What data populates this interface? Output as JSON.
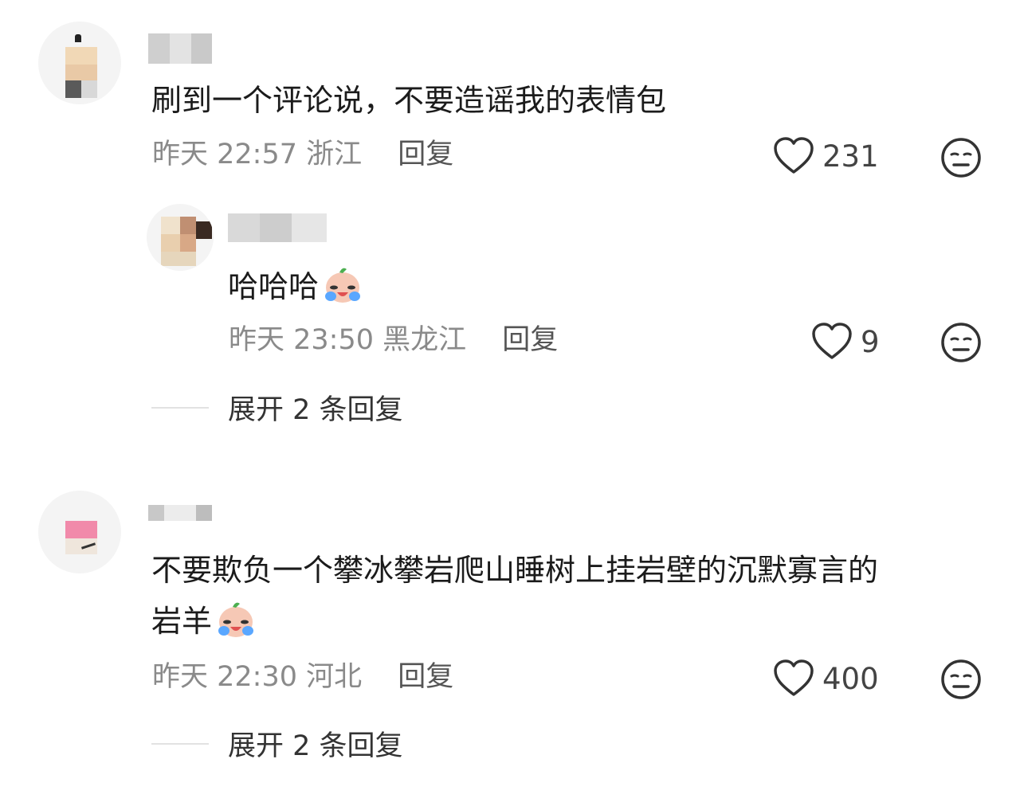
{
  "comments": [
    {
      "text": "刷到一个评论说，不要造谣我的表情包",
      "time": "昨天 22:57",
      "location": "浙江",
      "reply_label": "回复",
      "likes": "231",
      "reply": {
        "text": "哈哈哈",
        "emoji": "laugh-cry-emoji",
        "time": "昨天 23:50",
        "location": "黑龙江",
        "reply_label": "回复",
        "likes": "9"
      },
      "expand_label": "展开 2 条回复"
    },
    {
      "text_line1": "不要欺负一个攀冰攀岩爬山睡树上挂岩壁的沉默寡言的",
      "text_line2": "岩羊",
      "emoji": "laugh-cry-emoji",
      "time": "昨天 22:30",
      "location": "河北",
      "reply_label": "回复",
      "likes": "400",
      "expand_label": "展开 2 条回复"
    }
  ],
  "icons": {
    "like": "heart-outline-icon",
    "dislike": "neutral-face-icon"
  },
  "colors": {
    "background": "#ffffff",
    "text": "#1b1b1b",
    "meta": "#8a8a8a"
  }
}
